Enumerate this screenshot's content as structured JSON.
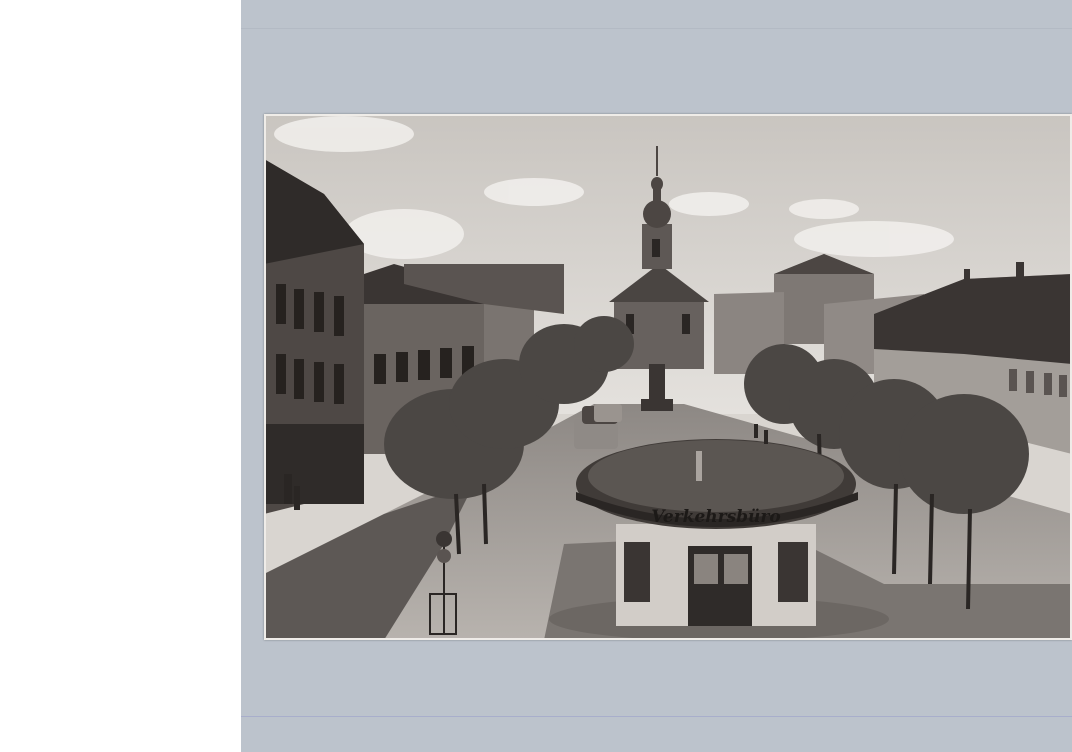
{
  "postcard": {
    "kiosk_sign": "Verkehrsbüro"
  },
  "colors": {
    "scan_background": "#bcc3cc",
    "paper_white": "#ffffff",
    "sepia_light": "#d9d5d0",
    "sepia_dark": "#2a2624"
  }
}
